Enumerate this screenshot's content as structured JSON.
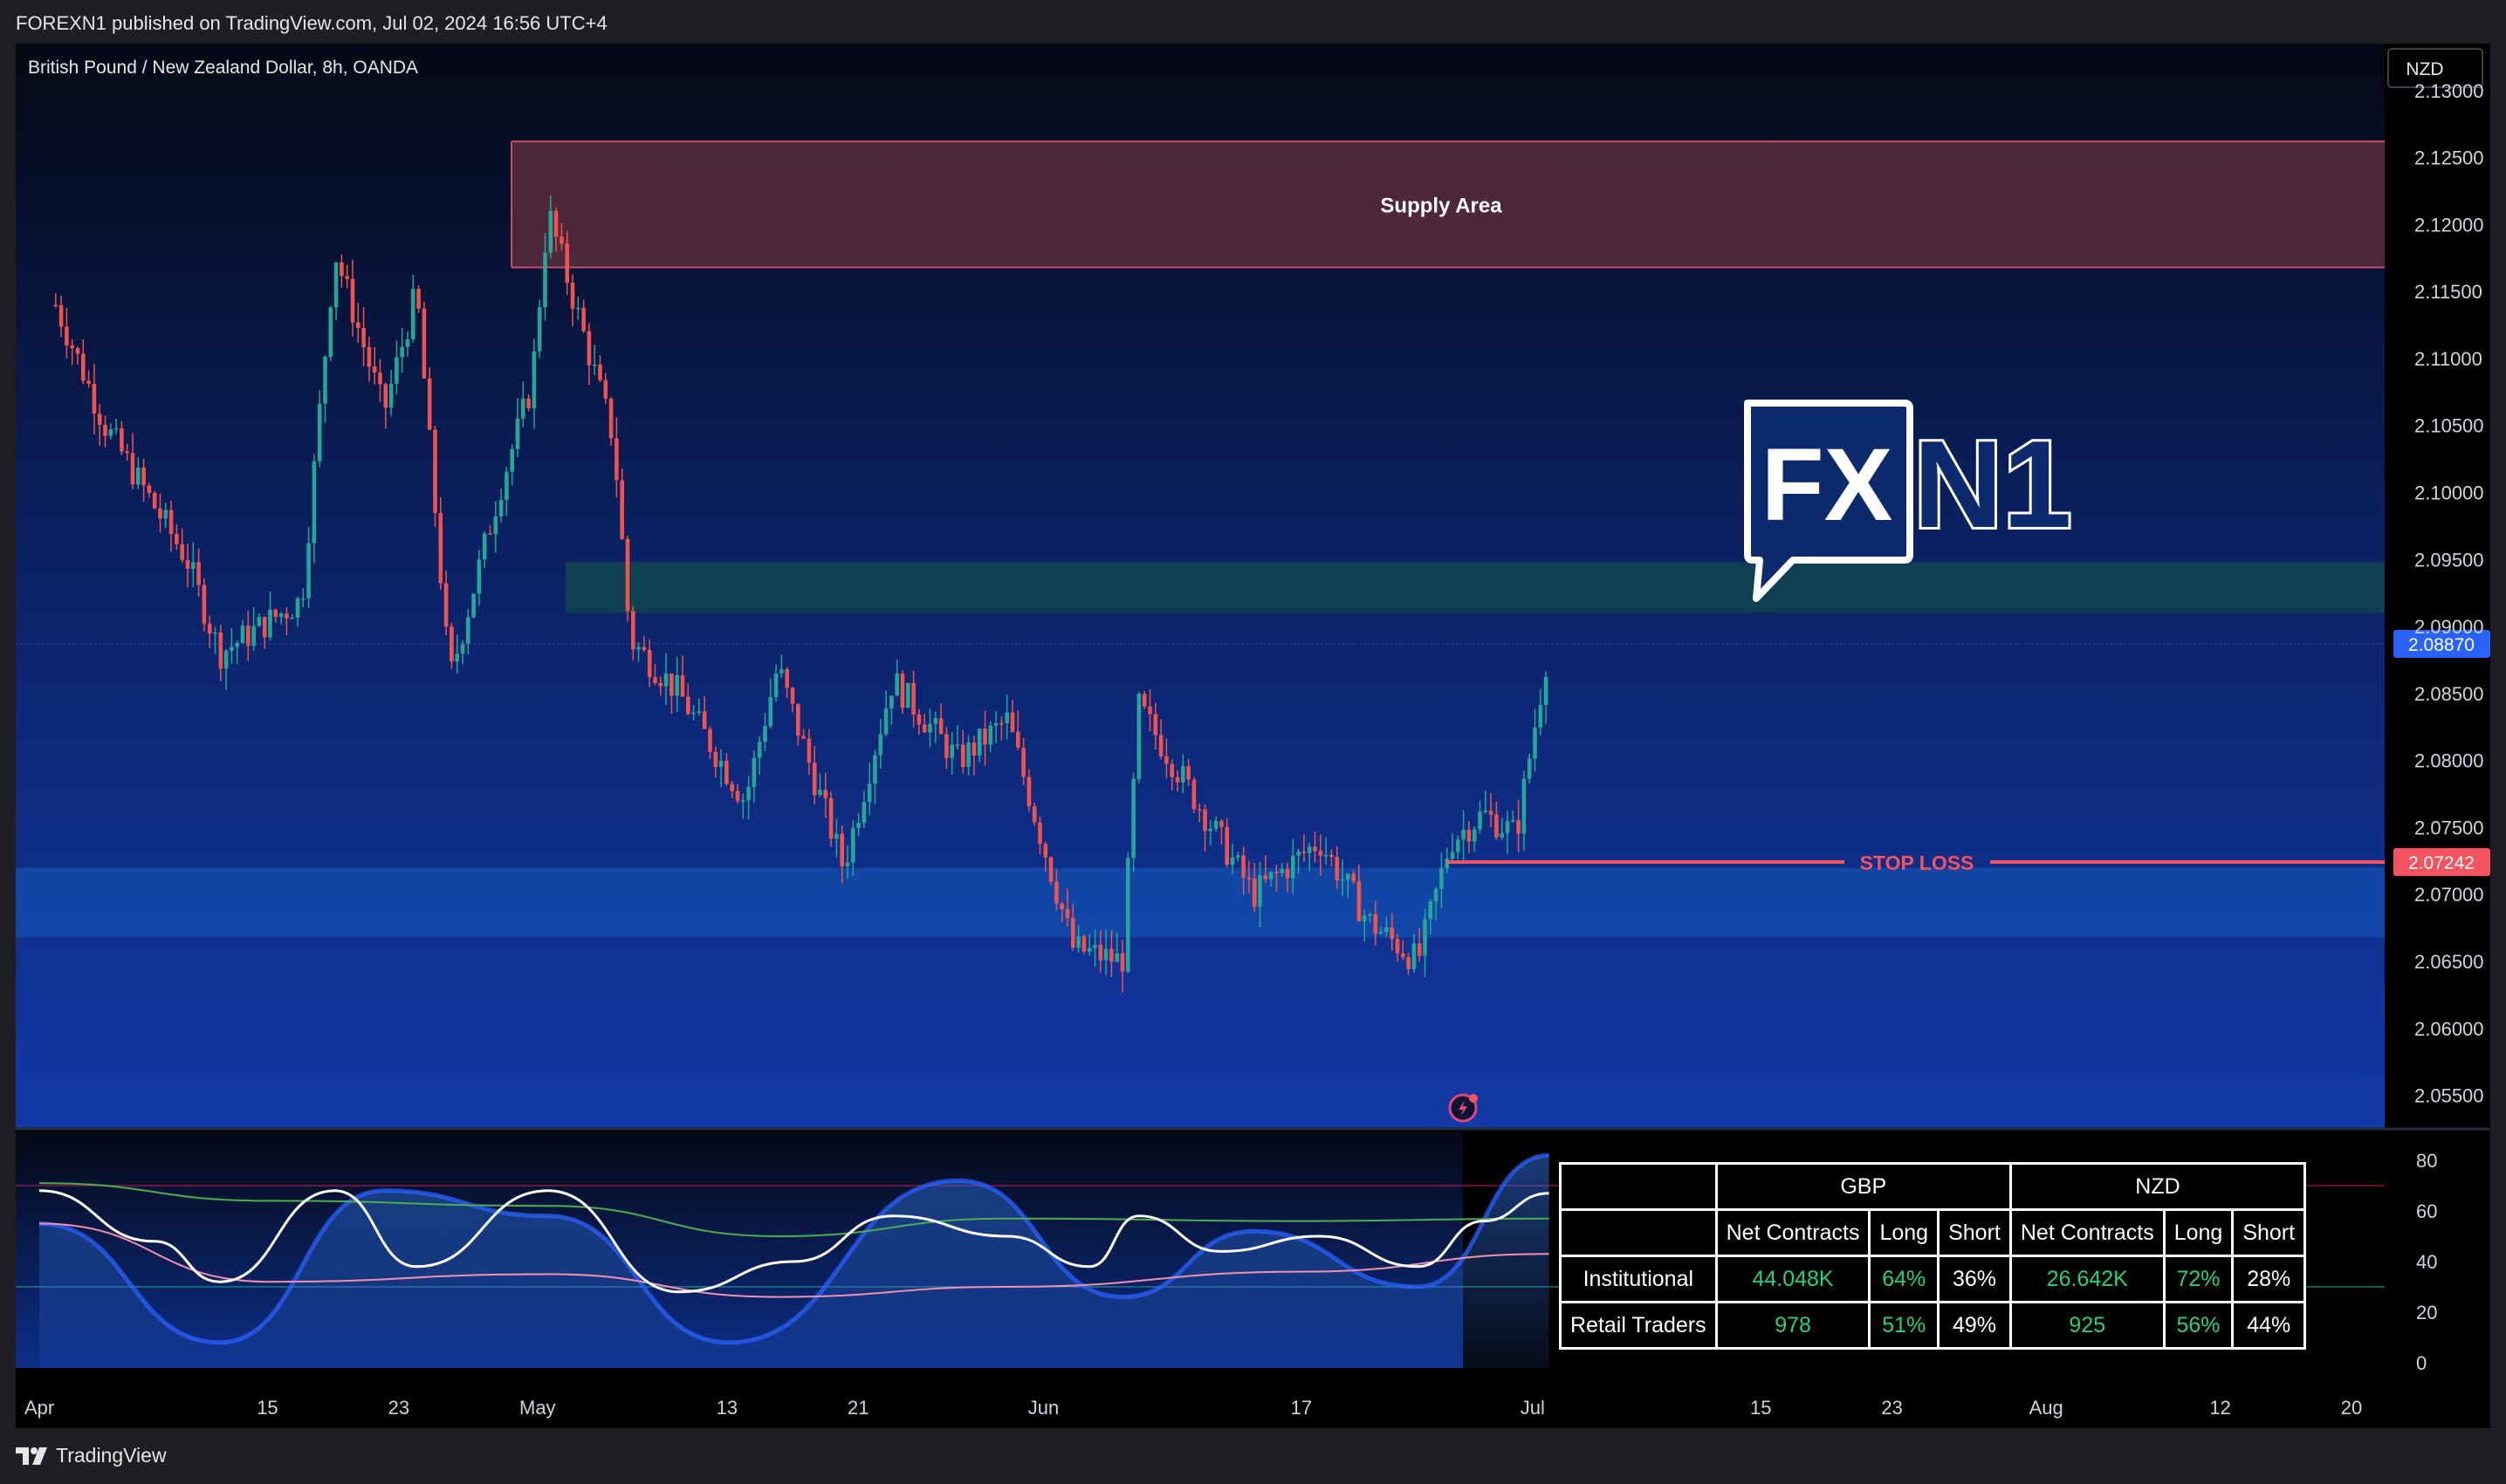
{
  "header": {
    "publish_text": "FOREXN1 published on TradingView.com, Jul 02, 2024 16:56 UTC+4"
  },
  "footer": {
    "brand": "TradingView"
  },
  "chart": {
    "symbol_title": "British Pound / New Zealand Dollar, 8h, OANDA",
    "currency_button": "NZD",
    "price_ticks": [
      "2.13000",
      "2.12500",
      "2.12000",
      "2.11500",
      "2.11000",
      "2.10500",
      "2.10000",
      "2.09500",
      "2.09000",
      "2.08500",
      "2.08000",
      "2.07500",
      "2.07000",
      "2.06500",
      "2.06000",
      "2.05500"
    ],
    "current_price_label": "2.08870",
    "stop_loss_price_label": "2.07242",
    "stop_loss_text": "STOP LOSS",
    "supply_zone_label": "Supply Area",
    "time_ticks": [
      "Apr",
      "15",
      "23",
      "May",
      "13",
      "21",
      "Jun",
      "17",
      "Jul",
      "15",
      "23",
      "Aug",
      "12",
      "20"
    ],
    "indicator_ticks": [
      "80",
      "60",
      "40",
      "20",
      "0"
    ],
    "logo": {
      "left": "FX",
      "right": "N1"
    },
    "colors": {
      "up": "#26a69a",
      "down": "#ef5350",
      "stop_loss": "#f7525f",
      "current_price": "#2962ff",
      "supply_fill": "#5a2d3c",
      "resistance_fill": "#0f4450",
      "demand_fill": "#1450b0",
      "oscillator_line": "#ffffff",
      "slow_line": "#4caf50",
      "signal_line": "#f48fb1"
    }
  },
  "chart_data": [
    {
      "type": "candlestick",
      "title": "British Pound / New Zealand Dollar, 8h, OANDA",
      "ylim": [
        2.0525,
        2.1335
      ],
      "zones": [
        {
          "label": "Supply Area",
          "from": 2.1168,
          "to": 2.1262
        },
        {
          "label": "",
          "from": 2.091,
          "to": 2.0948
        },
        {
          "label": "",
          "from": 2.0668,
          "to": 2.072
        }
      ],
      "stop_loss": 2.07242,
      "last_price": 2.0887,
      "keypoints": [
        {
          "date": "2024-04-02",
          "close": 2.114
        },
        {
          "date": "2024-04-05",
          "close": 2.105
        },
        {
          "date": "2024-04-10",
          "close": 2.095
        },
        {
          "date": "2024-04-12",
          "close": 2.088
        },
        {
          "date": "2024-04-17",
          "close": 2.092
        },
        {
          "date": "2024-04-19",
          "close": 2.118
        },
        {
          "date": "2024-04-22",
          "close": 2.106
        },
        {
          "date": "2024-04-24",
          "close": 2.115
        },
        {
          "date": "2024-04-26",
          "close": 2.086
        },
        {
          "date": "2024-04-29",
          "close": 2.1
        },
        {
          "date": "2024-05-01",
          "close": 2.108
        },
        {
          "date": "2024-05-02",
          "close": 2.121
        },
        {
          "date": "2024-05-06",
          "close": 2.104
        },
        {
          "date": "2024-05-07",
          "close": 2.089
        },
        {
          "date": "2024-05-10",
          "close": 2.085
        },
        {
          "date": "2024-05-14",
          "close": 2.077
        },
        {
          "date": "2024-05-16",
          "close": 2.087
        },
        {
          "date": "2024-05-20",
          "close": 2.072
        },
        {
          "date": "2024-05-23",
          "close": 2.086
        },
        {
          "date": "2024-05-27",
          "close": 2.08
        },
        {
          "date": "2024-05-30",
          "close": 2.083
        },
        {
          "date": "2024-06-03",
          "close": 2.066
        },
        {
          "date": "2024-06-06",
          "close": 2.065
        },
        {
          "date": "2024-06-07",
          "close": 2.084
        },
        {
          "date": "2024-06-11",
          "close": 2.076
        },
        {
          "date": "2024-06-14",
          "close": 2.07
        },
        {
          "date": "2024-06-18",
          "close": 2.074
        },
        {
          "date": "2024-06-21",
          "close": 2.068
        },
        {
          "date": "2024-06-24",
          "close": 2.065
        },
        {
          "date": "2024-06-26",
          "close": 2.074
        },
        {
          "date": "2024-06-28",
          "close": 2.076
        },
        {
          "date": "2024-06-30",
          "close": 2.0745
        },
        {
          "date": "2024-07-02",
          "close": 2.0887
        }
      ]
    },
    {
      "type": "line",
      "ylim": [
        0,
        80
      ],
      "hlines": [
        70,
        30
      ],
      "series": [
        {
          "color": "#ffffff",
          "keypoints": [
            {
              "date": "2024-04-01",
              "value": 68
            },
            {
              "date": "2024-04-08",
              "value": 48
            },
            {
              "date": "2024-04-12",
              "value": 32
            },
            {
              "date": "2024-04-19",
              "value": 68
            },
            {
              "date": "2024-04-24",
              "value": 38
            },
            {
              "date": "2024-05-02",
              "value": 68
            },
            {
              "date": "2024-05-10",
              "value": 28
            },
            {
              "date": "2024-05-17",
              "value": 40
            },
            {
              "date": "2024-05-23",
              "value": 58
            },
            {
              "date": "2024-05-30",
              "value": 50
            },
            {
              "date": "2024-06-04",
              "value": 38
            },
            {
              "date": "2024-06-07",
              "value": 58
            },
            {
              "date": "2024-06-12",
              "value": 44
            },
            {
              "date": "2024-06-18",
              "value": 50
            },
            {
              "date": "2024-06-24",
              "value": 38
            },
            {
              "date": "2024-06-28",
              "value": 56
            },
            {
              "date": "2024-07-02",
              "value": 67
            }
          ]
        },
        {
          "color": "#4caf50",
          "keypoints": [
            {
              "date": "2024-04-01",
              "value": 71
            },
            {
              "date": "2024-04-15",
              "value": 64
            },
            {
              "date": "2024-05-02",
              "value": 62
            },
            {
              "date": "2024-05-16",
              "value": 50
            },
            {
              "date": "2024-05-30",
              "value": 57
            },
            {
              "date": "2024-06-17",
              "value": 56
            },
            {
              "date": "2024-07-02",
              "value": 57
            }
          ]
        },
        {
          "color": "#f48fb1",
          "keypoints": [
            {
              "date": "2024-04-01",
              "value": 55
            },
            {
              "date": "2024-04-15",
              "value": 32
            },
            {
              "date": "2024-05-02",
              "value": 35
            },
            {
              "date": "2024-05-16",
              "value": 26
            },
            {
              "date": "2024-05-30",
              "value": 30
            },
            {
              "date": "2024-06-17",
              "value": 36
            },
            {
              "date": "2024-07-02",
              "value": 43
            }
          ]
        },
        {
          "color": "#2962ff",
          "keypoints": [
            {
              "date": "2024-04-01",
              "value": 55
            },
            {
              "date": "2024-04-12",
              "value": 8
            },
            {
              "date": "2024-04-22",
              "value": 68
            },
            {
              "date": "2024-05-02",
              "value": 58
            },
            {
              "date": "2024-05-13",
              "value": 8
            },
            {
              "date": "2024-05-27",
              "value": 72
            },
            {
              "date": "2024-06-06",
              "value": 26
            },
            {
              "date": "2024-06-14",
              "value": 52
            },
            {
              "date": "2024-06-24",
              "value": 30
            },
            {
              "date": "2024-07-02",
              "value": 82
            }
          ]
        }
      ]
    },
    {
      "type": "table",
      "groups": [
        "GBP",
        "NZD"
      ],
      "columns": [
        "Net Contracts",
        "Long",
        "Short",
        "Net Contracts",
        "Long",
        "Short"
      ],
      "rows": [
        {
          "label": "Institutional",
          "values": [
            "44.048K",
            "64%",
            "36%",
            "26.642K",
            "72%",
            "28%"
          ]
        },
        {
          "label": "Retail Traders",
          "values": [
            "978",
            "51%",
            "49%",
            "925",
            "56%",
            "44%"
          ]
        }
      ]
    }
  ]
}
